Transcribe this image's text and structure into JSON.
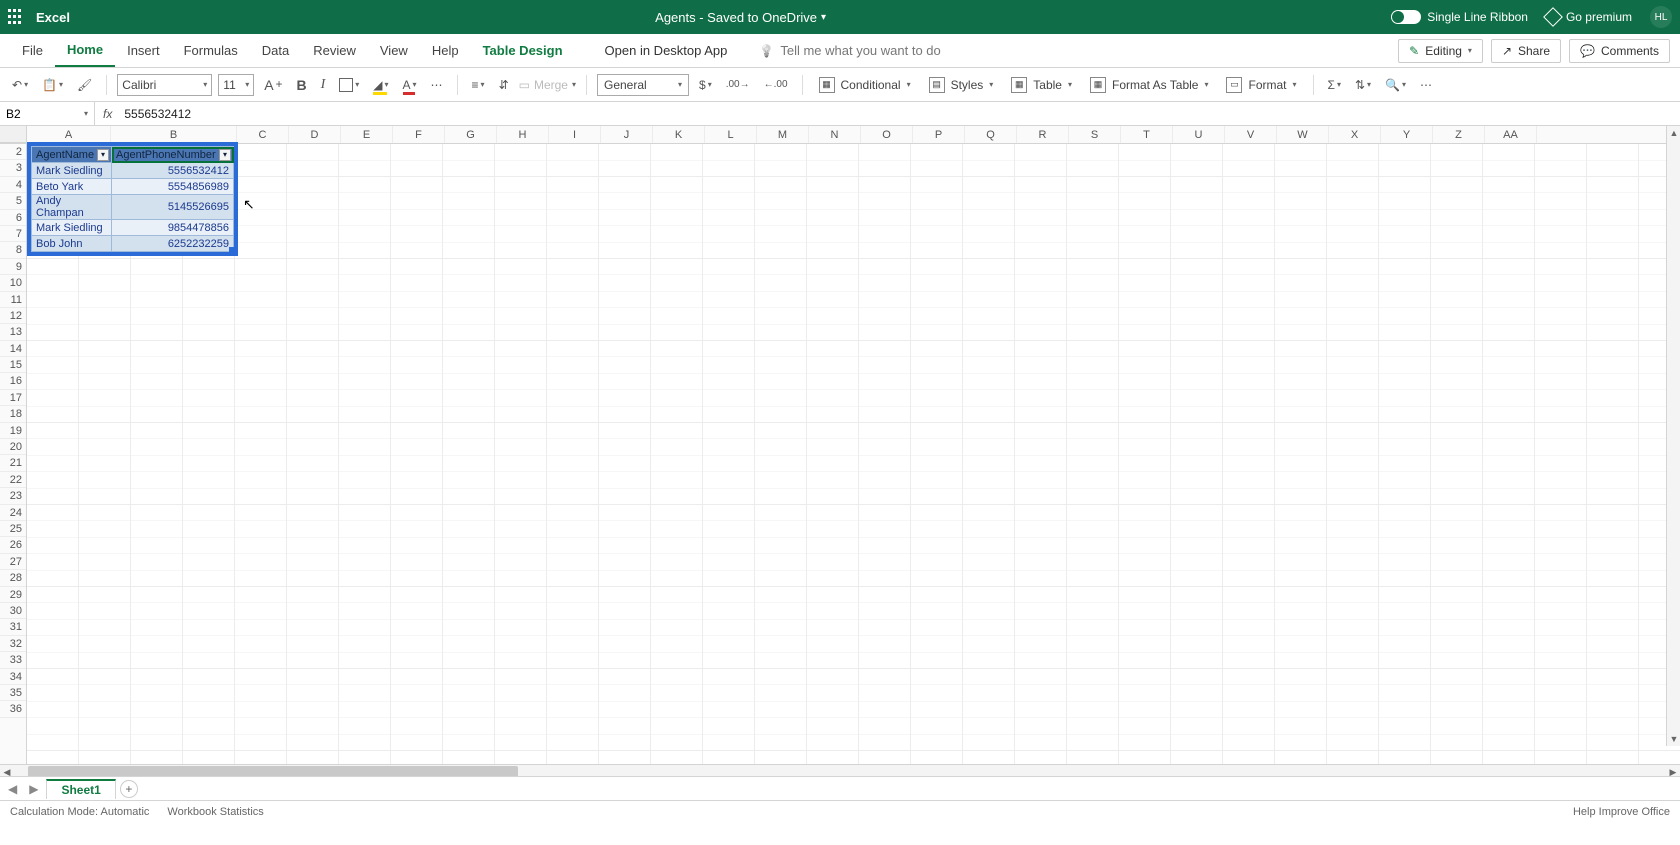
{
  "header": {
    "app_name": "Excel",
    "doc_title": "Agents - Saved to OneDrive",
    "single_line_ribbon": "Single Line Ribbon",
    "go_premium": "Go premium",
    "user_initials": "HL"
  },
  "ribbon": {
    "tabs": [
      "File",
      "Home",
      "Insert",
      "Formulas",
      "Data",
      "Review",
      "View",
      "Help",
      "Table Design"
    ],
    "open_in_desktop": "Open in Desktop App",
    "tell_me_placeholder": "Tell me what you want to do",
    "editing": "Editing",
    "share": "Share",
    "comments": "Comments"
  },
  "toolbar": {
    "font_name": "Calibri",
    "font_size": "11",
    "merge": "Merge",
    "number_format": "General",
    "conditional": "Conditional",
    "styles": "Styles",
    "table": "Table",
    "format_as_table": "Format As Table",
    "format": "Format"
  },
  "name_box": "B2",
  "formula_value": "5556532412",
  "columns": [
    "A",
    "B",
    "C",
    "D",
    "E",
    "F",
    "G",
    "H",
    "I",
    "J",
    "K",
    "L",
    "M",
    "N",
    "O",
    "P",
    "Q",
    "R",
    "S",
    "T",
    "U",
    "V",
    "W",
    "X",
    "Y",
    "Z",
    "AA"
  ],
  "rows_visible_start": 2,
  "rows_visible_end": 36,
  "table": {
    "headers": [
      "AgentName",
      "AgentPhoneNumber"
    ],
    "rows": [
      {
        "name": "Mark Siedling",
        "phone": "5556532412"
      },
      {
        "name": "Beto Yark",
        "phone": "5554856989"
      },
      {
        "name": "Andy Champan",
        "phone": "5145526695"
      },
      {
        "name": "Mark Siedling",
        "phone": "9854478856"
      },
      {
        "name": "Bob John",
        "phone": "6252232259"
      }
    ]
  },
  "sheet": {
    "active": "Sheet1"
  },
  "status": {
    "calc_mode": "Calculation Mode: Automatic",
    "workbook_stats": "Workbook Statistics",
    "help_improve": "Help Improve Office"
  }
}
